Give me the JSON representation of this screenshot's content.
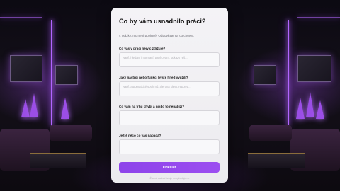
{
  "survey": {
    "title": "Co by vám usnadnilo práci?",
    "subtitle": "4 otázky, nic není povinné. Odpovězte na co chcete.",
    "questions": [
      {
        "label": "Co vás v práci nejvíc zdržuje?",
        "placeholder": "Např. hledání informací, papírování, odkazy reš..."
      },
      {
        "label": "Jaký nástroj nebo funkci byste hned využili?",
        "placeholder": "Např. automatické souhrnů, alert na slevy, reporty..."
      },
      {
        "label": "Co vám na trhu chybí a nikdo to nenabízí?",
        "placeholder": ""
      },
      {
        "label": "Ještě něco co vás napadá?",
        "placeholder": ""
      }
    ],
    "submit_label": "Odeslat",
    "footer": "Žádné osobní údaje nevyžadujeme"
  },
  "colors": {
    "accent": "#9347ec",
    "card_bg": "#f2f1f4"
  }
}
